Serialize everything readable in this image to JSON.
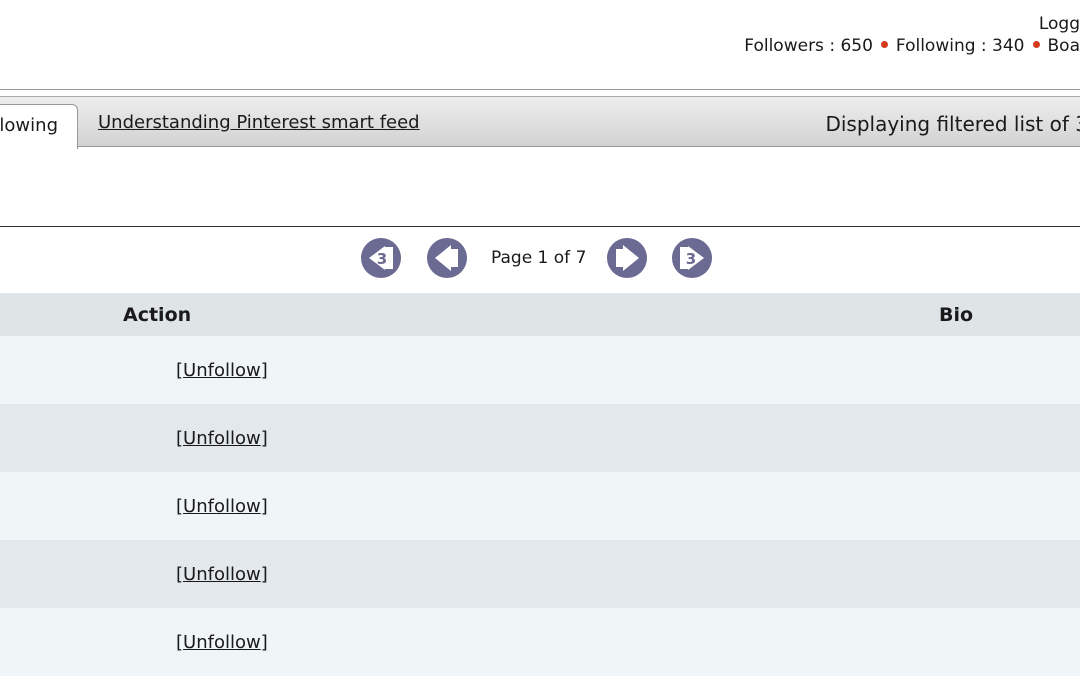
{
  "header": {
    "logged_text": "Logg",
    "followers": "Followers : 650",
    "following": "Following : 340",
    "boards": "Boa"
  },
  "tabs": {
    "active_tab": "lowing",
    "link_tab": "Understanding Pinterest smart feed"
  },
  "status": {
    "displaying": "Displaying filtered list of 3"
  },
  "pager": {
    "page_text": "Page 1 of 7"
  },
  "table": {
    "columns": [
      "Action",
      "Bio"
    ],
    "rows": [
      {
        "action_open": "[",
        "action": "Unfollow",
        "action_close": "]"
      },
      {
        "action_open": "[",
        "action": "Unfollow",
        "action_close": "]"
      },
      {
        "action_open": "[",
        "action": "Unfollow",
        "action_close": "]"
      },
      {
        "action_open": "[",
        "action": "Unfollow",
        "action_close": "]"
      },
      {
        "action_open": "[",
        "action": "Unfollow",
        "action_close": "]"
      }
    ]
  },
  "colors": {
    "pager_button": "#6b6a92",
    "dot": "#d23a1c",
    "header_row": "#dfe4e7"
  },
  "icons": [
    "first-page-icon",
    "previous-page-icon",
    "next-page-icon",
    "last-page-icon"
  ]
}
